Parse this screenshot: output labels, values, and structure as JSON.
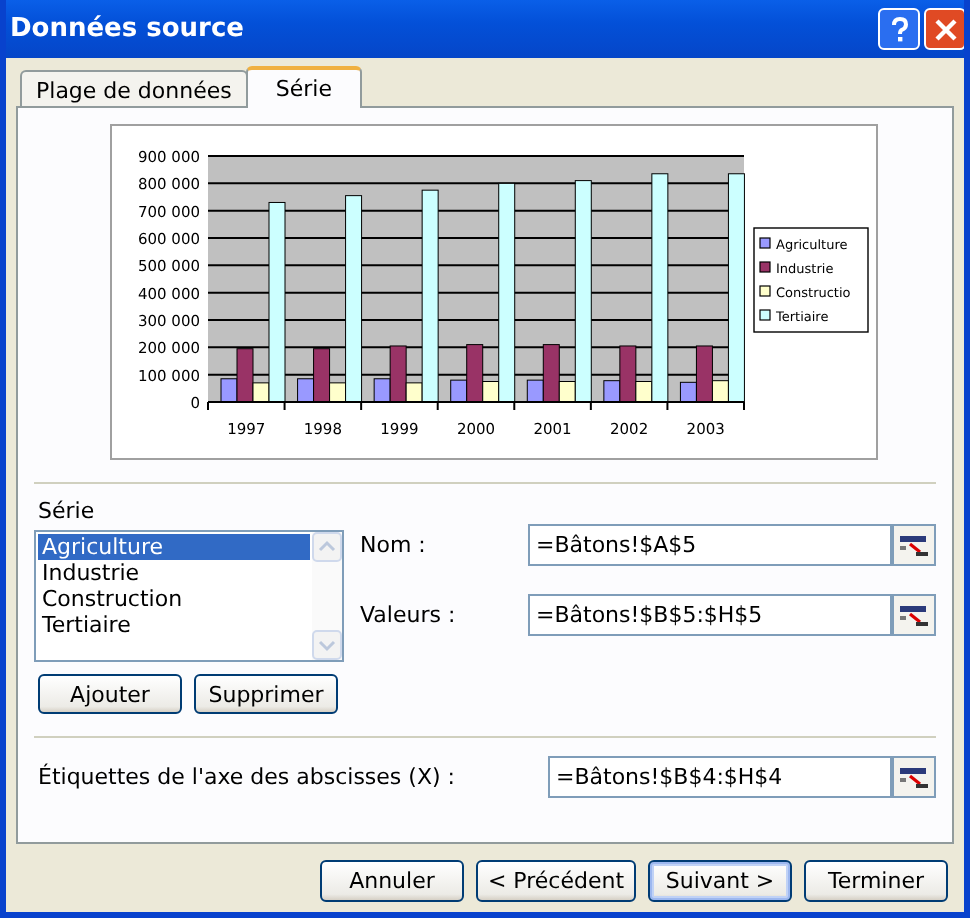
{
  "window": {
    "title": "Données source"
  },
  "tabs": [
    {
      "label": "Plage de données",
      "selected": false
    },
    {
      "label": "Série",
      "selected": true
    }
  ],
  "chart_data": {
    "type": "bar",
    "grid": true,
    "legend": true,
    "categories": [
      "1997",
      "1998",
      "1999",
      "2000",
      "2001",
      "2002",
      "2003"
    ],
    "ylim": [
      0,
      900000
    ],
    "yticks": [
      {
        "value": 0,
        "label": "0"
      },
      {
        "value": 100000,
        "label": "100 000"
      },
      {
        "value": 200000,
        "label": "200 000"
      },
      {
        "value": 300000,
        "label": "300 000"
      },
      {
        "value": 400000,
        "label": "400 000"
      },
      {
        "value": 500000,
        "label": "500 000"
      },
      {
        "value": 600000,
        "label": "600 000"
      },
      {
        "value": 700000,
        "label": "700 000"
      },
      {
        "value": 800000,
        "label": "800 000"
      },
      {
        "value": 900000,
        "label": "900 000"
      }
    ],
    "series": [
      {
        "name": "Agriculture",
        "color": "#9999ff",
        "values": [
          85000,
          85000,
          85000,
          80000,
          80000,
          78000,
          72000
        ]
      },
      {
        "name": "Industrie",
        "color": "#993366",
        "values": [
          195000,
          195000,
          205000,
          210000,
          210000,
          205000,
          205000
        ]
      },
      {
        "name": "Constructio",
        "color": "#ffffcc",
        "values": [
          70000,
          70000,
          70000,
          75000,
          75000,
          75000,
          78000
        ]
      },
      {
        "name": "Tertiaire",
        "color": "#ccffff",
        "values": [
          730000,
          755000,
          775000,
          800000,
          810000,
          835000,
          835000
        ]
      }
    ]
  },
  "series_group": {
    "label": "Série",
    "items": [
      {
        "label": "Agriculture",
        "selected": true
      },
      {
        "label": "Industrie",
        "selected": false
      },
      {
        "label": "Construction",
        "selected": false
      },
      {
        "label": "Tertiaire",
        "selected": false
      }
    ],
    "buttons": [
      "Ajouter",
      "Supprimer"
    ]
  },
  "fields": [
    {
      "label": "Nom :",
      "value": "=Bâtons!$A$5"
    },
    {
      "label": "Valeurs :",
      "value": "=Bâtons!$B$5:$H$5"
    }
  ],
  "axis_field": {
    "label": "Étiquettes de l'axe des abscisses (X) :",
    "value": "=Bâtons!$B$4:$H$4"
  },
  "buttons": [
    {
      "label": "Annuler",
      "default": false
    },
    {
      "label": "< Précédent",
      "default": false
    },
    {
      "label": "Suivant >",
      "default": true
    },
    {
      "label": "Terminer",
      "default": false
    }
  ]
}
